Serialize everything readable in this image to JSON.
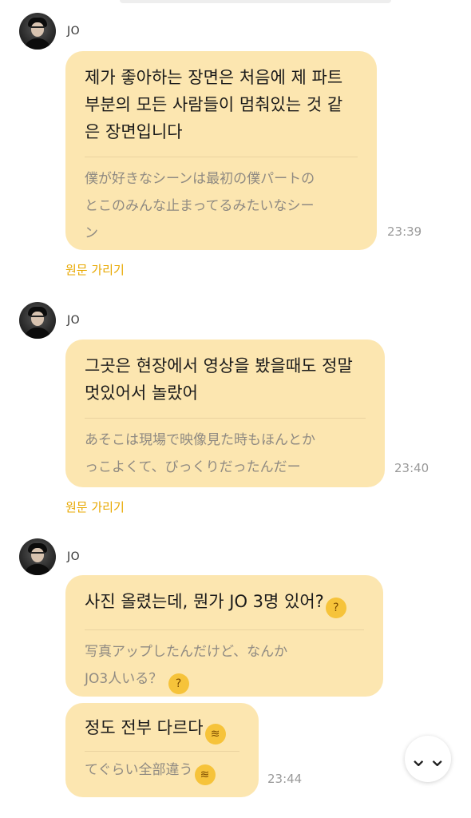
{
  "messages": [
    {
      "sender": "JO",
      "ko": [
        "제가 좋아하는 장면은 처음에 제 파트",
        "부분의 모든 사람들이 멈춰있는 것 같",
        "은 장면입니다"
      ],
      "ja": [
        "僕が好きなシーンは最初の僕パートの",
        "とこのみんな止まってるみたいなシー",
        "ン"
      ],
      "time": "23:39",
      "hide_original": "원문 가리기"
    },
    {
      "sender": "JO",
      "ko": [
        "그곳은 현장에서 영상을 봤을때도 정말",
        "멋있어서 놀랐어"
      ],
      "ja": [
        "あそこは現場で映像見た時もほんとか",
        "っこよくて、びっくりだったんだー"
      ],
      "time": "23:40",
      "hide_original": "원문 가리기"
    },
    {
      "sender": "JO",
      "ko": [
        "사진 올렸는데, 뭔가 JO 3명 있어?"
      ],
      "ja": [
        "写真アップしたんだけど、なんか",
        "JO3人いる？"
      ],
      "emoji": "thinking-face-emoji"
    },
    {
      "ko": [
        "정도 전부 다르다"
      ],
      "ja": [
        "てぐらい全部違う"
      ],
      "emoji": "rofl-emoji",
      "time": "23:44"
    }
  ],
  "emoji_glyphs": {
    "thinking": "?",
    "rofl": "≋"
  },
  "scroll_button": "⌄⌄"
}
